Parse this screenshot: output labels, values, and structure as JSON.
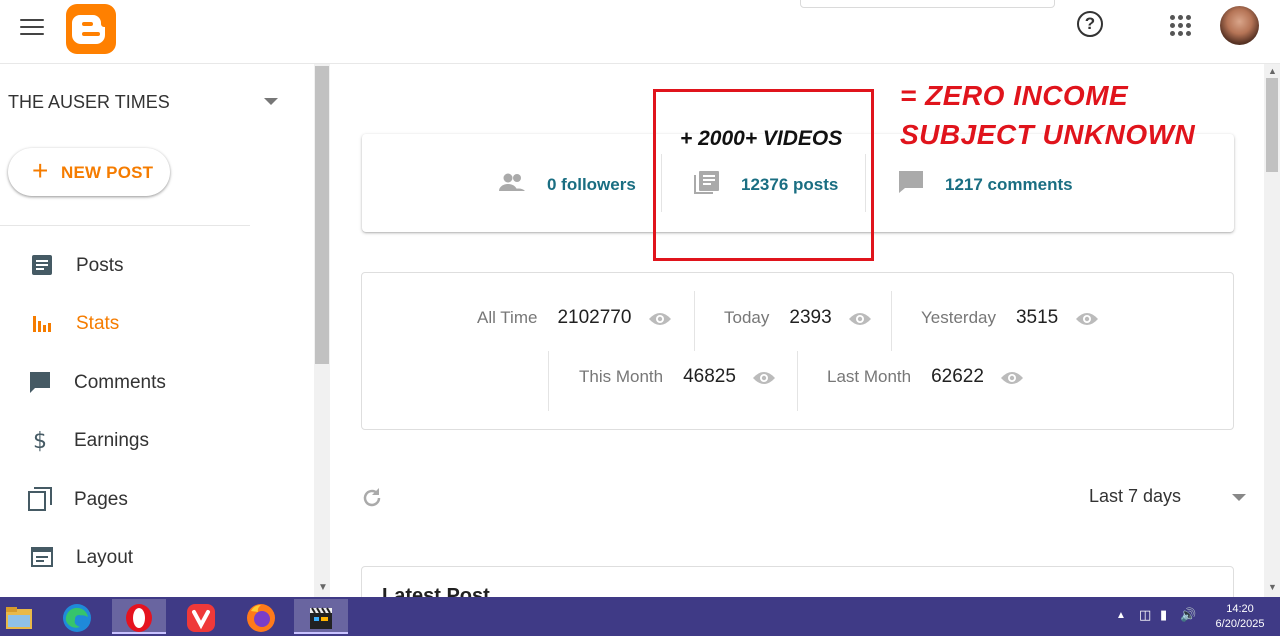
{
  "blog": {
    "name": "THE AUSER TIMES"
  },
  "new_post": {
    "plus": "+",
    "label": "NEW POST"
  },
  "nav": [
    {
      "label": "Posts",
      "icon": "posts-icon",
      "active": false
    },
    {
      "label": "Stats",
      "icon": "stats-icon",
      "active": true
    },
    {
      "label": "Comments",
      "icon": "comments-icon",
      "active": false
    },
    {
      "label": "Earnings",
      "icon": "earnings-icon",
      "active": false
    },
    {
      "label": "Pages",
      "icon": "pages-icon",
      "active": false
    },
    {
      "label": "Layout",
      "icon": "layout-icon",
      "active": false
    }
  ],
  "header": {
    "help_glyph": "?"
  },
  "summary": {
    "followers": "0 followers",
    "posts": "12376 posts",
    "comments": "1217 comments"
  },
  "views": {
    "all_time": {
      "label": "All Time",
      "value": "2102770"
    },
    "today": {
      "label": "Today",
      "value": "2393"
    },
    "yesterday": {
      "label": "Yesterday",
      "value": "3515"
    },
    "this_month": {
      "label": "This Month",
      "value": "46825"
    },
    "last_month": {
      "label": "Last Month",
      "value": "62622"
    }
  },
  "range": {
    "selected": "Last 7 days"
  },
  "latest_post": {
    "title": "Latest Post"
  },
  "annotations": {
    "videos": "+ 2000+ VIDEOS",
    "line1": "= ZERO INCOME",
    "line2": "SUBJECT UNKNOWN"
  },
  "taskbar": {
    "apps": [
      "file-explorer-icon",
      "edge-icon",
      "opera-icon",
      "vivaldi-icon",
      "firefox-icon",
      "video-editor-icon"
    ],
    "time": "14:20",
    "date": "6/20/2025"
  },
  "colors": {
    "accent": "#f57c00",
    "stat_link": "#1a6e82",
    "annotation_red": "#e0141c",
    "taskbar": "#3f3a86"
  }
}
